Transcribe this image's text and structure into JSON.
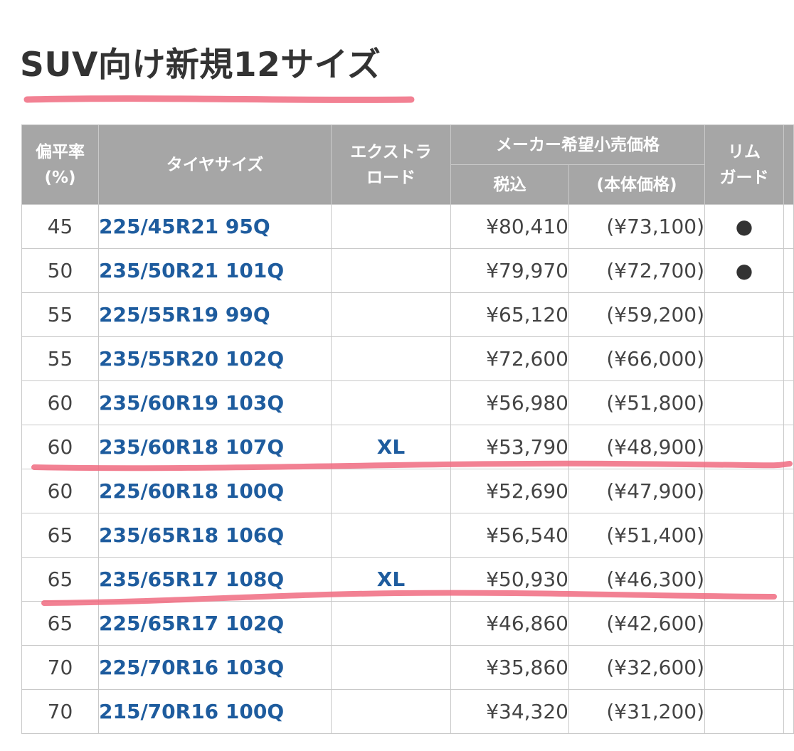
{
  "title": "SUV向け新規12サイズ",
  "headers": {
    "flatness": "偏平率\n(%)",
    "size": "タイヤサイズ",
    "extra_load": "エクストラ\nロード",
    "msrp": "メーカー希望小売価格",
    "tax_in": "税込",
    "base_price": "(本体価格)",
    "rim_guard": "リム\nガード"
  },
  "rows": [
    {
      "flatness": "45",
      "size": "225/45R21 95Q",
      "xl": "",
      "price": "¥80,410",
      "base": "(¥73,100)",
      "rim": "●"
    },
    {
      "flatness": "50",
      "size": "235/50R21 101Q",
      "xl": "",
      "price": "¥79,970",
      "base": "(¥72,700)",
      "rim": "●"
    },
    {
      "flatness": "55",
      "size": "225/55R19 99Q",
      "xl": "",
      "price": "¥65,120",
      "base": "(¥59,200)",
      "rim": ""
    },
    {
      "flatness": "55",
      "size": "235/55R20 102Q",
      "xl": "",
      "price": "¥72,600",
      "base": "(¥66,000)",
      "rim": ""
    },
    {
      "flatness": "60",
      "size": "235/60R19 103Q",
      "xl": "",
      "price": "¥56,980",
      "base": "(¥51,800)",
      "rim": ""
    },
    {
      "flatness": "60",
      "size": "235/60R18 107Q",
      "xl": "XL",
      "price": "¥53,790",
      "base": "(¥48,900)",
      "rim": ""
    },
    {
      "flatness": "60",
      "size": "225/60R18 100Q",
      "xl": "",
      "price": "¥52,690",
      "base": "(¥47,900)",
      "rim": ""
    },
    {
      "flatness": "65",
      "size": "235/65R18 106Q",
      "xl": "",
      "price": "¥56,540",
      "base": "(¥51,400)",
      "rim": ""
    },
    {
      "flatness": "65",
      "size": "235/65R17 108Q",
      "xl": "XL",
      "price": "¥50,930",
      "base": "(¥46,300)",
      "rim": ""
    },
    {
      "flatness": "65",
      "size": "225/65R17 102Q",
      "xl": "",
      "price": "¥46,860",
      "base": "(¥42,600)",
      "rim": ""
    },
    {
      "flatness": "70",
      "size": "225/70R16 103Q",
      "xl": "",
      "price": "¥35,860",
      "base": "(¥32,600)",
      "rim": ""
    },
    {
      "flatness": "70",
      "size": "215/70R16 100Q",
      "xl": "",
      "price": "¥34,320",
      "base": "(¥31,200)",
      "rim": ""
    }
  ],
  "colors": {
    "header_bg": "#a6a6a6",
    "size_text": "#1e5c9e",
    "highlight": "#f06b80"
  }
}
